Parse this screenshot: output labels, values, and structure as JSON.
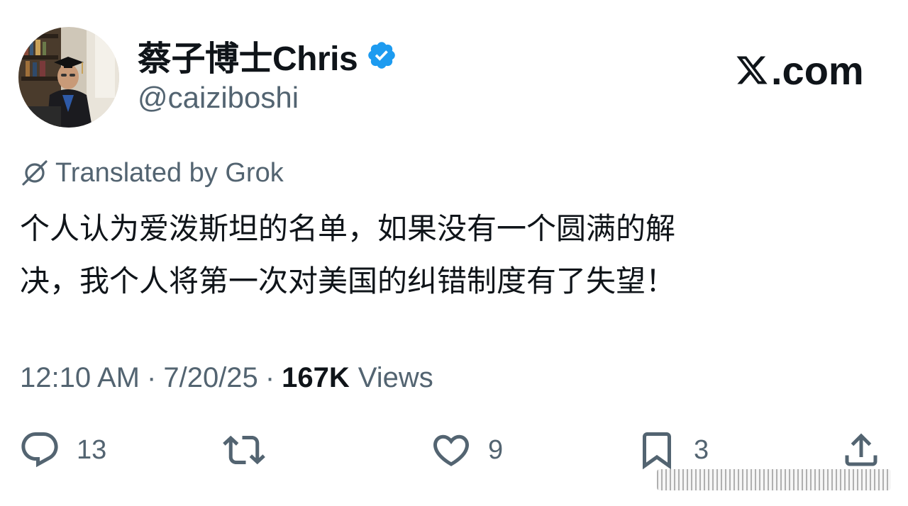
{
  "author": {
    "display_name": "蔡子博士Chris",
    "handle": "@caiziboshi",
    "verified_color": "#1d9bf0"
  },
  "brand": {
    "logo_text": ".com",
    "logo_mark": "x-logo-icon"
  },
  "translation": {
    "label": "Translated by Grok"
  },
  "tweet": {
    "text": "个人认为爱泼斯坦的名单，如果没有一个圆满的解\n决，我个人将第一次对美国的纠错制度有了失望！"
  },
  "meta": {
    "time": "12:10 AM",
    "separator": "·",
    "date": "7/20/25",
    "views_count": "167K",
    "views_label": "Views"
  },
  "actions": {
    "reply_count": "13",
    "like_count": "9",
    "bookmark_count": "3"
  },
  "colors": {
    "text_primary": "#0f1419",
    "text_secondary": "#536471",
    "accent": "#1d9bf0"
  }
}
